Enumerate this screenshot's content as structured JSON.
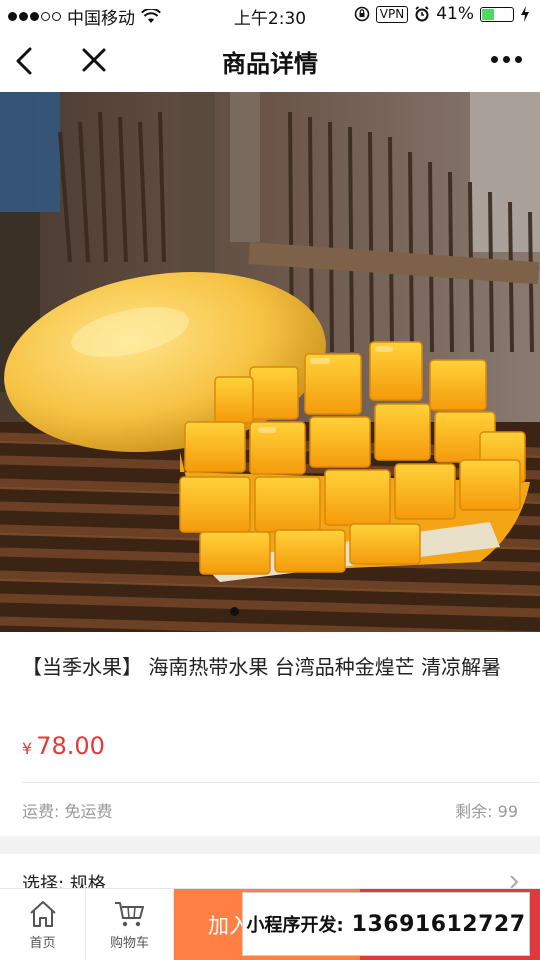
{
  "status_bar": {
    "carrier": "中国移动",
    "time": "上午2:30",
    "vpn": "VPN",
    "battery": "41%",
    "battery_level": 0.41,
    "signal_bars_filled": 3,
    "signal_bars_total": 5
  },
  "nav": {
    "title": "商品详情",
    "back_icon": "chevron-left-icon",
    "close_icon": "close-icon",
    "more_icon": "more-dots-icon"
  },
  "product": {
    "title": "【当季水果】 海南热带水果 台湾品种金煌芒 清凉解暑",
    "currency": "¥",
    "price": "78.00",
    "shipping": "运费: 免运费",
    "stock": "剩余: 99",
    "select_label": "选择: 规格"
  },
  "bottom_bar": {
    "home_label": "首页",
    "cart_label": "购物车",
    "add_to_cart": "加入",
    "buy_now": ""
  },
  "ad": {
    "label": "小程序开发:",
    "phone": "13691612727"
  },
  "colors": {
    "price": "#e4393c",
    "add_to_cart_bg": "#ff7f44",
    "buy_now_bg": "#e4393c",
    "battery_fill": "#4cd964"
  }
}
